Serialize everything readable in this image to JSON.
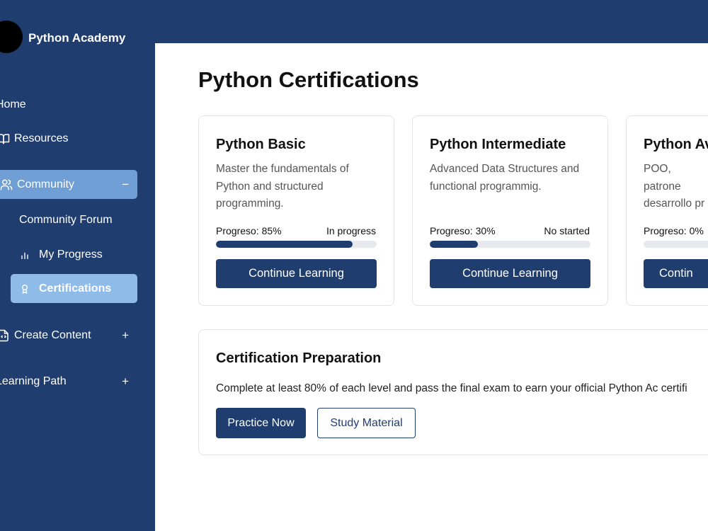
{
  "brand": {
    "name": "Python Academy"
  },
  "sidebar": {
    "home": {
      "label": "Home",
      "icon": "home-icon"
    },
    "resources": {
      "label": "Resources",
      "icon": "book-icon"
    },
    "community": {
      "label": "Community",
      "icon": "users-icon",
      "toggle": "−"
    },
    "community_forum": {
      "label": "Community Forum"
    },
    "my_progress": {
      "label": "My Progress",
      "icon": "bar-chart-icon"
    },
    "certifications": {
      "label": "Certifications",
      "icon": "award-icon"
    },
    "create_content": {
      "label": "Create Content",
      "icon": "code-file-icon",
      "toggle": "+"
    },
    "learning_path": {
      "label": "Learning Path",
      "toggle": "+"
    }
  },
  "main": {
    "title": "Python Certifications",
    "cards": [
      {
        "title": "Python Basic",
        "description": "Master the fundamentals of Python and structured programming.",
        "progress_label": "Progreso: 85%",
        "progress_value": 85,
        "status": "In progress",
        "button": "Continue Learning"
      },
      {
        "title": "Python Intermediate",
        "description": "Advanced Data Structures and functional programmig.",
        "progress_label": "Progreso: 30%",
        "progress_value": 30,
        "status": "No started",
        "button": "Continue Learning"
      },
      {
        "title": "Python Av",
        "description": "POO, patrone desarrollo pr",
        "progress_label": "Progreso: 0%",
        "progress_value": 0,
        "status": "",
        "button": "Contin"
      }
    ],
    "preparation": {
      "title": "Certification Preparation",
      "text": "Complete at least 80% of each level and pass the final exam to earn your official Python Ac certifi",
      "primary_button": "Practice Now",
      "secondary_button": "Study Material"
    }
  },
  "colors": {
    "primary": "#1f3d6e",
    "community_highlight": "#6f9fd4",
    "active_highlight": "#8fbbe8",
    "progress_track": "#e7e9ee"
  }
}
